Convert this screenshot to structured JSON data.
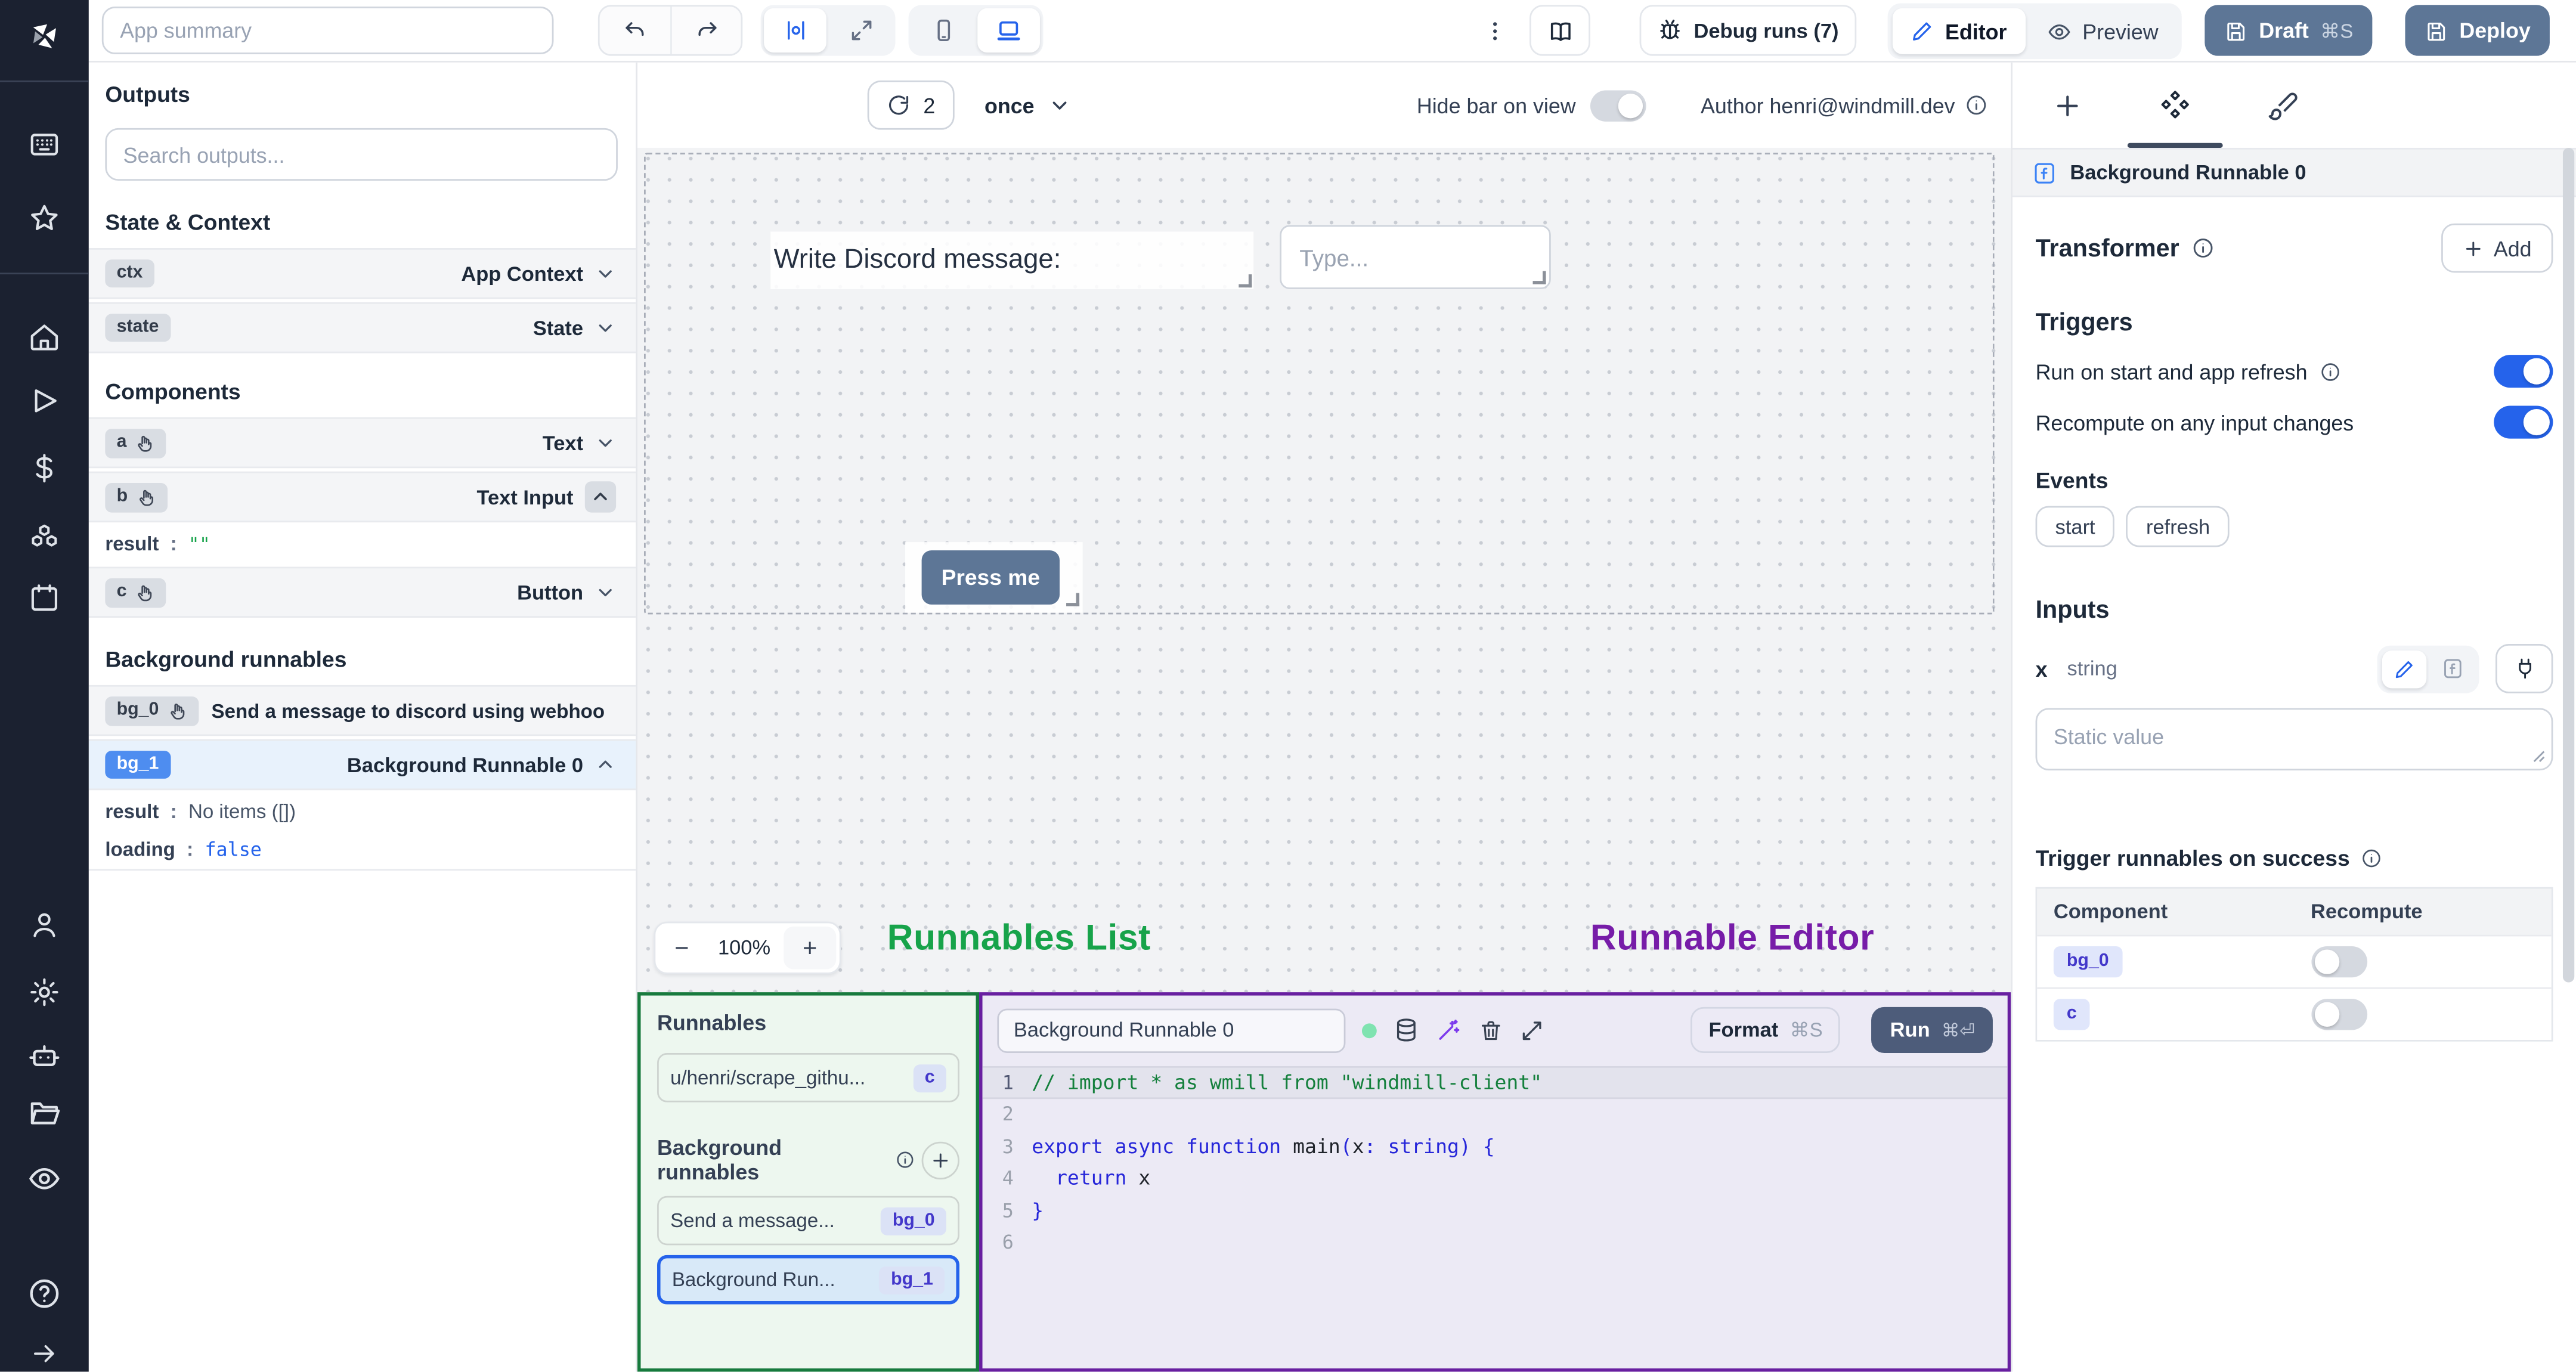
{
  "topbar": {
    "app_summary_placeholder": "App summary",
    "debug_runs_label": "Debug runs (7)",
    "editor_label": "Editor",
    "preview_label": "Preview",
    "draft_label": "Draft",
    "draft_shortcut": "⌘S",
    "deploy_label": "Deploy"
  },
  "left_panel": {
    "outputs_title": "Outputs",
    "search_placeholder": "Search outputs...",
    "state_context_title": "State & Context",
    "ctx": {
      "id": "ctx",
      "type": "App Context"
    },
    "state": {
      "id": "state",
      "type": "State"
    },
    "components_title": "Components",
    "comp_a": {
      "id": "a",
      "type": "Text"
    },
    "comp_b": {
      "id": "b",
      "type": "Text Input",
      "result_key": "result",
      "result_value": "\"\""
    },
    "comp_c": {
      "id": "c",
      "type": "Button"
    },
    "background_title": "Background runnables",
    "bg0": {
      "id": "bg_0",
      "label": "Send a message to discord using webhoo"
    },
    "bg1": {
      "id": "bg_1",
      "label": "Background Runnable 0",
      "result_key": "result",
      "result_value": "No items ([])",
      "loading_key": "loading",
      "loading_value": "false"
    }
  },
  "canvas_bar": {
    "refresh_count": "2",
    "schedule": "once",
    "hide_bar_label": "Hide bar on view",
    "author_label": "Author henri@windmill.dev"
  },
  "canvas": {
    "text_component": "Write Discord message:",
    "input_placeholder": "Type...",
    "button_label": "Press me",
    "zoom_out": "−",
    "zoom_level": "100%",
    "zoom_in": "+"
  },
  "annotations": {
    "runnables_list": "Runnables List",
    "runnable_editor": "Runnable Editor",
    "list_color": "#17a34a",
    "editor_color": "#771ca8"
  },
  "runnables_panel": {
    "title": "Runnables",
    "script_item": {
      "label": "u/henri/scrape_githu...",
      "badge": "c"
    },
    "background_title": "Background runnables",
    "bg0_item": {
      "label": "Send a message...",
      "badge": "bg_0"
    },
    "bg1_item": {
      "label": "Background Run...",
      "badge": "bg_1"
    }
  },
  "editor_panel": {
    "name": "Background Runnable 0",
    "format_label": "Format",
    "format_shortcut": "⌘S",
    "run_label": "Run",
    "run_shortcut": "⌘⏎",
    "code": [
      {
        "num": "1",
        "highlight": true,
        "tokens": [
          {
            "text": "// import * as wmill from \"windmill-client\"",
            "type": "cm"
          }
        ]
      },
      {
        "num": "2",
        "tokens": []
      },
      {
        "num": "3",
        "tokens": [
          {
            "text": "export async function ",
            "type": "kw"
          },
          {
            "text": "main",
            "type": "id"
          },
          {
            "text": "(",
            "type": "pn"
          },
          {
            "text": "x",
            "type": "id"
          },
          {
            "text": ": ",
            "type": "pn"
          },
          {
            "text": "string",
            "type": "kw"
          },
          {
            "text": ") {",
            "type": "pn"
          }
        ]
      },
      {
        "num": "4",
        "tokens": [
          {
            "text": "  ",
            "type": "id"
          },
          {
            "text": "return",
            "type": "kw"
          },
          {
            "text": " x",
            "type": "id"
          }
        ]
      },
      {
        "num": "5",
        "tokens": [
          {
            "text": "}",
            "type": "pn"
          }
        ]
      },
      {
        "num": "6",
        "tokens": []
      }
    ]
  },
  "right_panel": {
    "header_title": "Background Runnable 0",
    "transformer_title": "Transformer",
    "add_label": "Add",
    "triggers_title": "Triggers",
    "trigger_rows": [
      {
        "label": "Run on start and app refresh",
        "enabled": true
      },
      {
        "label": "Recompute on any input changes",
        "enabled": true
      }
    ],
    "events_title": "Events",
    "event_chips": [
      "start",
      "refresh"
    ],
    "inputs_title": "Inputs",
    "input_name": "x",
    "input_type": "string",
    "static_placeholder": "Static value",
    "trigger_success_title": "Trigger runnables on success",
    "table": {
      "headers": [
        "Component",
        "Recompute"
      ],
      "rows": [
        {
          "id": "bg_0",
          "recompute": false
        },
        {
          "id": "c",
          "recompute": false
        }
      ]
    }
  },
  "colors": {
    "accent_blue": "#2563eb",
    "slate_button": "#5d7696",
    "run_button": "#4d5c7a",
    "selected_badge": "#4e8df0",
    "green_panel_border": "#177a3d",
    "purple_panel_border": "#681fa0"
  }
}
